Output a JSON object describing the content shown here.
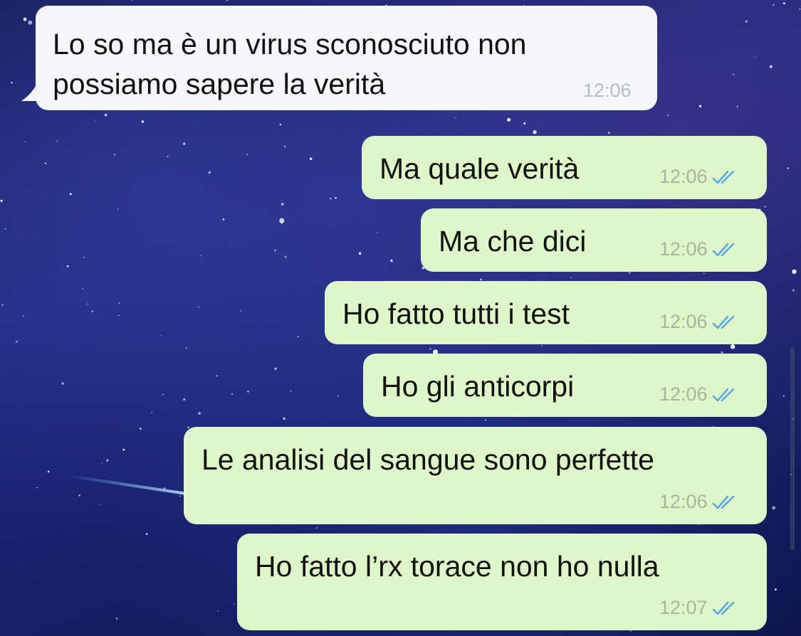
{
  "messages": [
    {
      "direction": "incoming",
      "text_lines": [
        "Lo so ma è un virus sconosciuto non",
        "possiamo sapere la verità"
      ],
      "time": "12:06"
    },
    {
      "direction": "outgoing",
      "text": "Ma quale verità",
      "time": "12:06",
      "status": "read"
    },
    {
      "direction": "outgoing",
      "text": "Ma che dici",
      "time": "12:06",
      "status": "read"
    },
    {
      "direction": "outgoing",
      "text": "Ho fatto tutti i test",
      "time": "12:06",
      "status": "read"
    },
    {
      "direction": "outgoing",
      "text": "Ho gli anticorpi",
      "time": "12:06",
      "status": "read"
    },
    {
      "direction": "outgoing",
      "text": "Le analisi del sangue sono perfette",
      "time": "12:06",
      "status": "read"
    },
    {
      "direction": "outgoing",
      "text": "Ho fatto l’rx torace non ho nulla",
      "time": "12:07",
      "status": "read"
    }
  ],
  "theme": {
    "incoming_bubble": "#f5f7fa",
    "outgoing_bubble": "#dff7c8",
    "read_tick_color": "#5aa9e6",
    "wallpaper": "starry-night-sky"
  }
}
